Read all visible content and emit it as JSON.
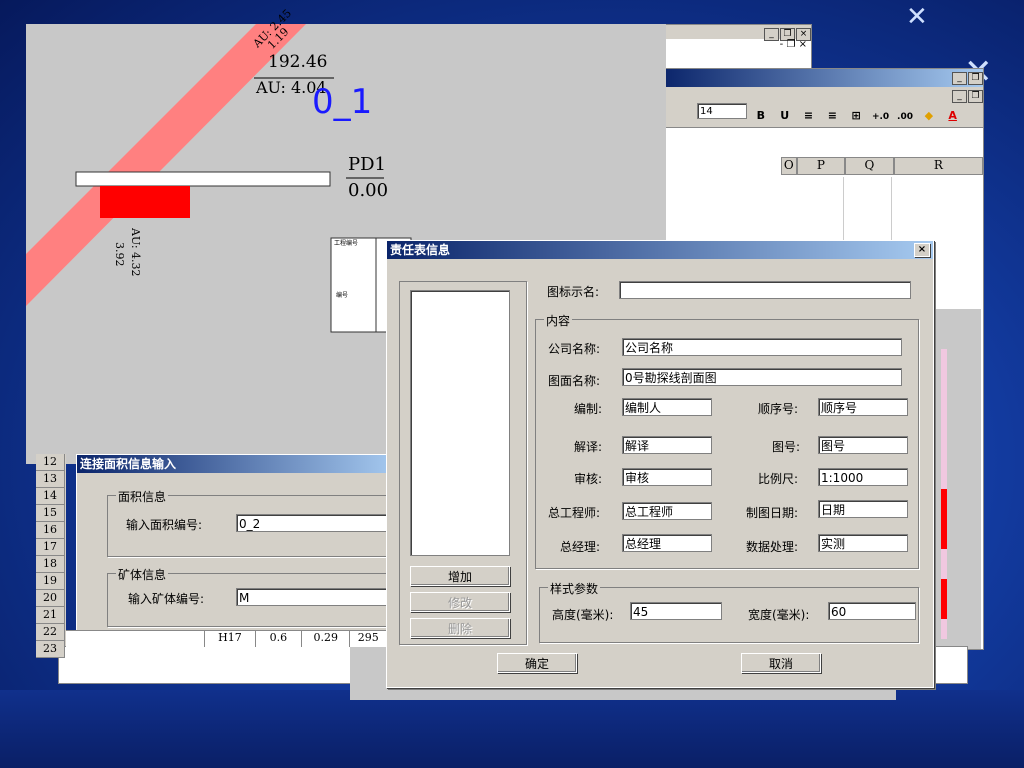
{
  "excel": {
    "font_size": "14",
    "toolbar": [
      "B",
      "U",
      "≡",
      "≡",
      "⊞",
      "+.0",
      ".00",
      "A"
    ],
    "columns": [
      "O",
      "P",
      "Q",
      "R"
    ]
  },
  "drawing": {
    "label_top_rot": "1.19",
    "label_top_rot2": "AU: 2.45",
    "value1": "192.46",
    "au1": "AU: 4.04",
    "sample_id": "0_1",
    "pd_name": "PD1",
    "pd_value": "0.00",
    "rot_value": "3.92",
    "rot_au": "AU: 4.32",
    "table_tag1": "工程编号",
    "table_tag2": "编号"
  },
  "area_dialog": {
    "title": "连接面积信息输入",
    "area_group": "面积信息",
    "area_label": "输入面积编号:",
    "area_value": "0_2",
    "ore_group": "矿体信息",
    "ore_label": "输入矿体编号:",
    "ore_value": "M",
    "rows": [
      "12",
      "13",
      "14",
      "15",
      "16",
      "17",
      "18",
      "19",
      "20",
      "21",
      "22",
      "23"
    ],
    "bottom_row": [
      "H17",
      "0.6",
      "0.29",
      "295"
    ]
  },
  "resp_dialog": {
    "title": "责任表信息",
    "icon_label": "图标示名:",
    "icon_value": "",
    "content_group": "内容",
    "company_label": "公司名称:",
    "company_value": "公司名称",
    "map_label": "图面名称:",
    "map_value": "0号勘探线剖面图",
    "editor_label": "编制:",
    "editor_value": "编制人",
    "seq_label": "顺序号:",
    "seq_value": "顺序号",
    "interp_label": "解译:",
    "interp_value": "解译",
    "figno_label": "图号:",
    "figno_value": "图号",
    "review_label": "审核:",
    "review_value": "审核",
    "scale_label": "比例尺:",
    "scale_value": "1:1000",
    "chief_label": "总工程师:",
    "chief_value": "总工程师",
    "date_label": "制图日期:",
    "date_value": "日期",
    "gm_label": "总经理:",
    "gm_value": "总经理",
    "data_label": "数据处理:",
    "data_value": "实测",
    "style_group": "样式参数",
    "height_label": "高度(毫米):",
    "height_value": "45",
    "width_label": "宽度(毫米):",
    "width_value": "60",
    "add_btn": "增加",
    "edit_btn": "修改",
    "delete_btn": "删除",
    "ok_btn": "确定",
    "cancel_btn": "取消",
    "close": "×"
  },
  "colors": {
    "title_start": "#0a246a",
    "title_end": "#a6caf0",
    "ore_red": "#ff0000",
    "ore_band": "#ff8080",
    "sample_blue": "#1a1aff"
  }
}
